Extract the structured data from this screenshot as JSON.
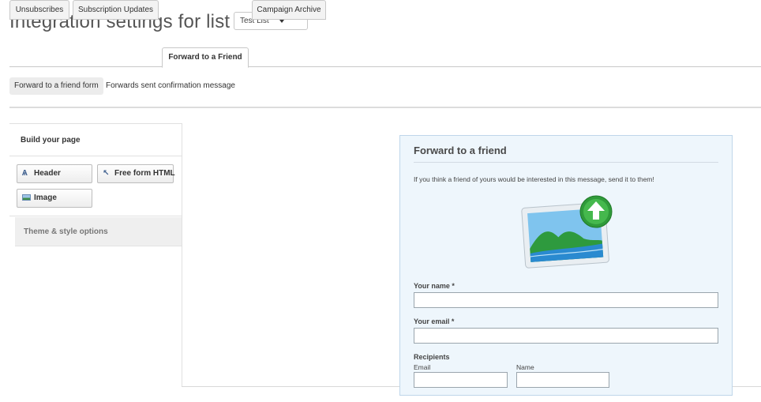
{
  "header": {
    "title": "Integration settings for list",
    "list_select": "Test List"
  },
  "tabs": [
    "Unsubscribes",
    "Subscription Updates",
    "Forward to a Friend",
    "Campaign Archive"
  ],
  "subtabs": [
    "Forward to a friend form",
    "Forwards sent confirmation message"
  ],
  "builder": {
    "heading": "Build your page",
    "header_btn": "Header",
    "html_btn": "Free form HTML",
    "image_btn": "Image",
    "theme": "Theme & style options"
  },
  "form": {
    "title": "Forward to a friend",
    "intro": "If you think a friend of yours would be interested in this message, send it to them!",
    "name_label": "Your name *",
    "email_label": "Your email *",
    "recipients_label": "Recipients",
    "recipient_email": "Email",
    "recipient_name": "Name"
  },
  "colors": {
    "panel_bg": "#eef6fc",
    "arrow_green": "#3aa53a"
  }
}
